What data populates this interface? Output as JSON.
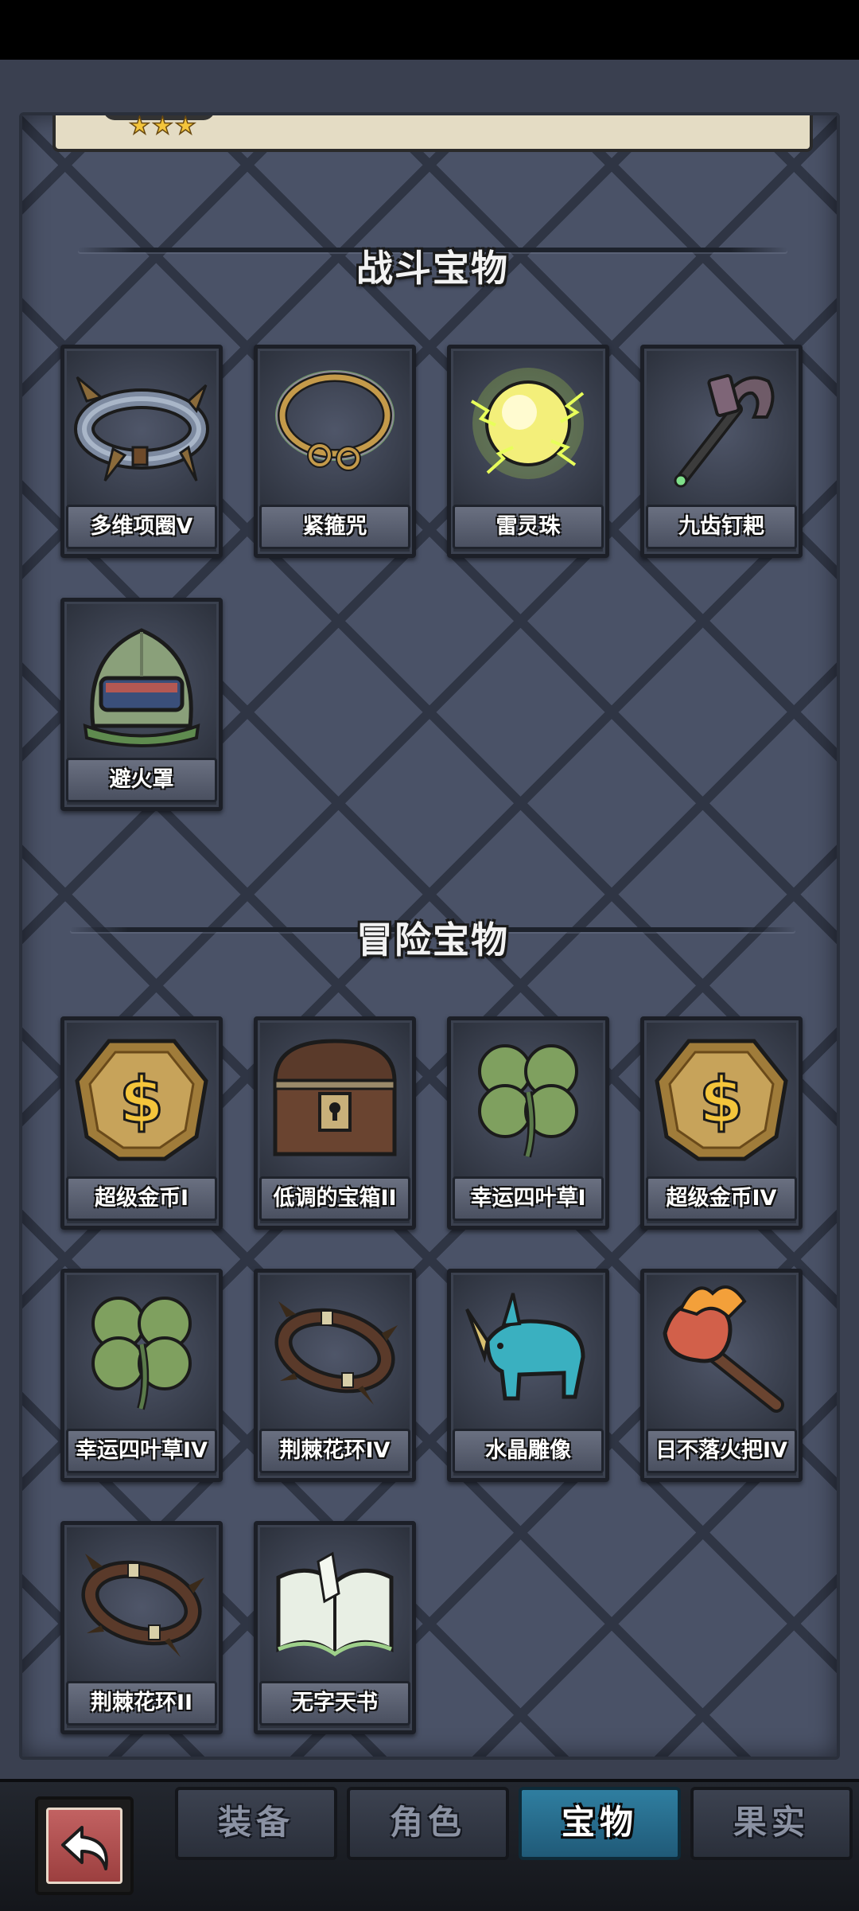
{
  "top_card": {
    "stars": "★★★"
  },
  "sections": {
    "battle": {
      "title": "战斗宝物",
      "items": [
        {
          "label": "多维项圈V",
          "icon": "spiked-collar-icon"
        },
        {
          "label": "紧箍咒",
          "icon": "golden-headband-icon"
        },
        {
          "label": "雷灵珠",
          "icon": "thunder-orb-icon"
        },
        {
          "label": "九齿钉耙",
          "icon": "nine-tooth-rake-icon"
        },
        {
          "label": "避火罩",
          "icon": "fire-helmet-icon"
        }
      ]
    },
    "adventure": {
      "title": "冒险宝物",
      "items": [
        {
          "label": "超级金币I",
          "icon": "gold-coin-icon"
        },
        {
          "label": "低调的宝箱II",
          "icon": "treasure-chest-icon"
        },
        {
          "label": "幸运四叶草I",
          "icon": "four-leaf-clover-icon"
        },
        {
          "label": "超级金币IV",
          "icon": "gold-coin-icon"
        },
        {
          "label": "幸运四叶草IV",
          "icon": "four-leaf-clover-icon"
        },
        {
          "label": "荆棘花环IV",
          "icon": "thorn-wreath-icon"
        },
        {
          "label": "水晶雕像",
          "icon": "crystal-statue-icon"
        },
        {
          "label": "日不落火把IV",
          "icon": "torch-icon"
        },
        {
          "label": "荆棘花环II",
          "icon": "thorn-wreath-icon"
        },
        {
          "label": "无字天书",
          "icon": "blank-book-icon"
        }
      ]
    }
  },
  "bottom_nav": {
    "back_icon": "back-arrow-icon",
    "tabs": [
      "装备",
      "角色",
      "宝物",
      "果实"
    ],
    "active_tab": "宝物"
  },
  "colors": {
    "panel": "#4a5267",
    "active_tab": "#2f7ea0",
    "back_button": "#b05252",
    "star": "#f4c53b"
  }
}
